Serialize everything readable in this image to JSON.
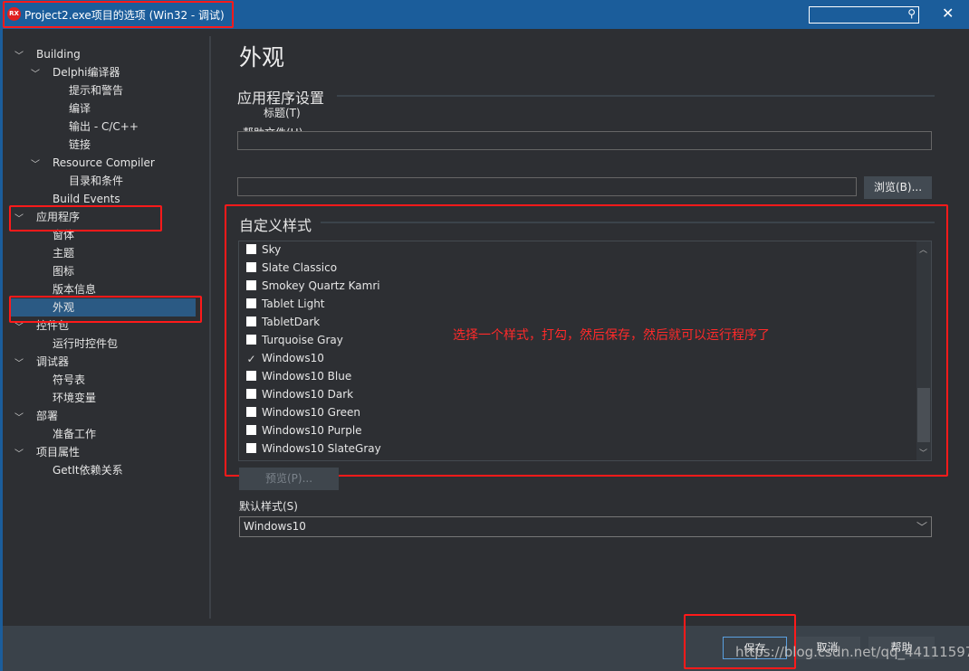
{
  "window": {
    "icon_text": "RX",
    "title": "Project2.exe项目的选项  (Win32 - 调试)"
  },
  "tree": [
    {
      "label": "Building",
      "level": 0,
      "expanded": true
    },
    {
      "label": "Delphi编译器",
      "level": 1,
      "expanded": true
    },
    {
      "label": "提示和警告",
      "level": 2
    },
    {
      "label": "编译",
      "level": 2
    },
    {
      "label": "输出 - C/C++",
      "level": 2
    },
    {
      "label": "链接",
      "level": 2
    },
    {
      "label": "Resource Compiler",
      "level": 1,
      "expanded": true
    },
    {
      "label": "目录和条件",
      "level": 2
    },
    {
      "label": "Build Events",
      "level": 1
    },
    {
      "label": "应用程序",
      "level": 0,
      "expanded": true
    },
    {
      "label": "窗体",
      "level": 1
    },
    {
      "label": "主题",
      "level": 1
    },
    {
      "label": "图标",
      "level": 1
    },
    {
      "label": "版本信息",
      "level": 1
    },
    {
      "label": "外观",
      "level": 1,
      "selected": true
    },
    {
      "label": "控件包",
      "level": 0,
      "expanded": true
    },
    {
      "label": "运行时控件包",
      "level": 1
    },
    {
      "label": "调试器",
      "level": 0,
      "expanded": true
    },
    {
      "label": "符号表",
      "level": 1
    },
    {
      "label": "环境变量",
      "level": 1
    },
    {
      "label": "部署",
      "level": 0,
      "expanded": true
    },
    {
      "label": "准备工作",
      "level": 1
    },
    {
      "label": "项目属性",
      "level": 0,
      "expanded": true
    },
    {
      "label": "GetIt依赖关系",
      "level": 1
    }
  ],
  "main": {
    "title": "外观",
    "app_settings": "应用程序设置",
    "title_label": "标题(T)",
    "help_file_label": "帮助文件(H)",
    "browse": "浏览(B)...",
    "custom_styles": "自定义样式",
    "styles": [
      {
        "name": "Sky",
        "checked": false
      },
      {
        "name": "Slate Classico",
        "checked": false
      },
      {
        "name": "Smokey Quartz Kamri",
        "checked": false
      },
      {
        "name": "Tablet Light",
        "checked": false
      },
      {
        "name": "TabletDark",
        "checked": false
      },
      {
        "name": "Turquoise Gray",
        "checked": false
      },
      {
        "name": "Windows10",
        "checked": true
      },
      {
        "name": "Windows10 Blue",
        "checked": false
      },
      {
        "name": "Windows10 Dark",
        "checked": false
      },
      {
        "name": "Windows10 Green",
        "checked": false
      },
      {
        "name": "Windows10 Purple",
        "checked": false
      },
      {
        "name": "Windows10 SlateGray",
        "checked": false
      }
    ],
    "annotation": "选择一个样式，打勾，然后保存，然后就可以运行程序了",
    "preview": "预览(P)...",
    "default_style_label": "默认样式(S)",
    "default_style_value": "Windows10"
  },
  "footer": {
    "save": "保存",
    "cancel": "取消",
    "help": "帮助",
    "watermark": "https://blog.csdn.net/qq_44111597"
  }
}
